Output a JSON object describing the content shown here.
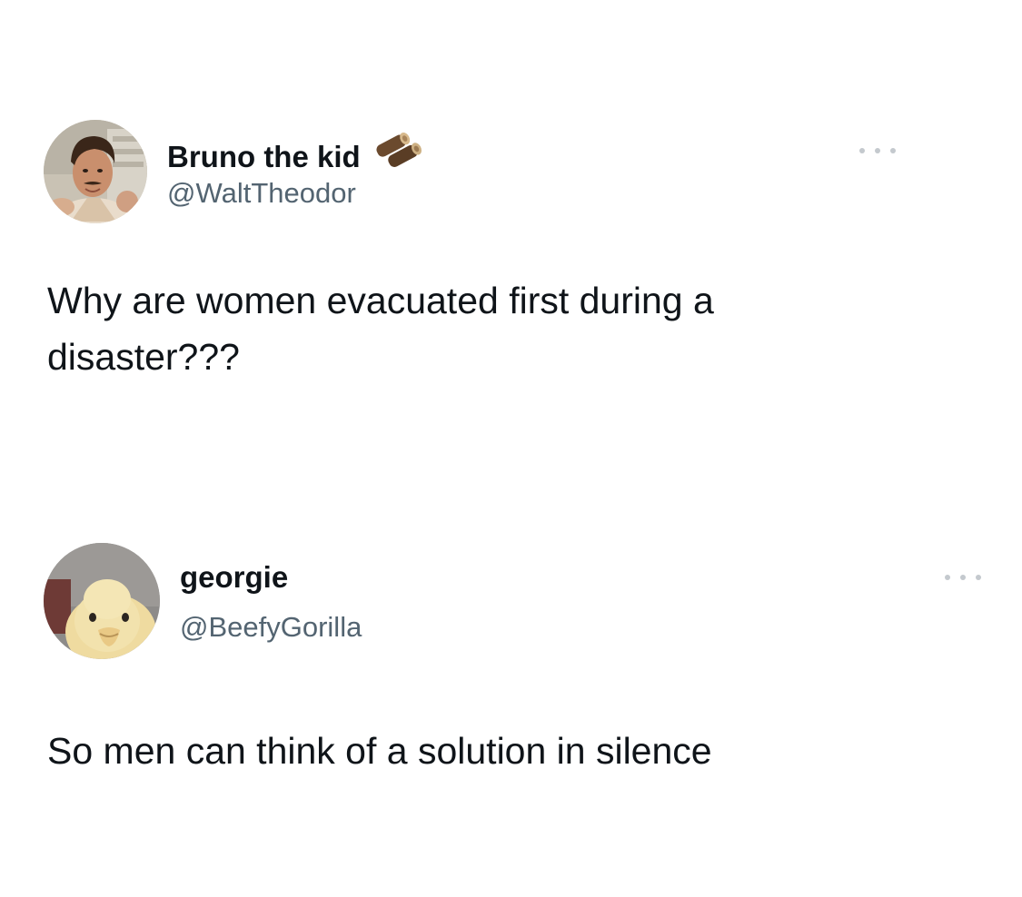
{
  "tweets": [
    {
      "display_name": "Bruno the kid",
      "badge_icon": "wood-log-icon",
      "handle": "@WaltTheodor",
      "text": "Why are women evacuated first during a\ndisaster???",
      "more_icon": "more-options-icon"
    },
    {
      "display_name": "georgie",
      "handle": "@BeefyGorilla",
      "text": "So men can think of a solution in silence",
      "more_icon": "more-options-icon"
    }
  ],
  "colors": {
    "text": "#0f1419",
    "secondary_text": "#536471",
    "more_dots": "#c4c9ce",
    "background": "#ffffff"
  }
}
